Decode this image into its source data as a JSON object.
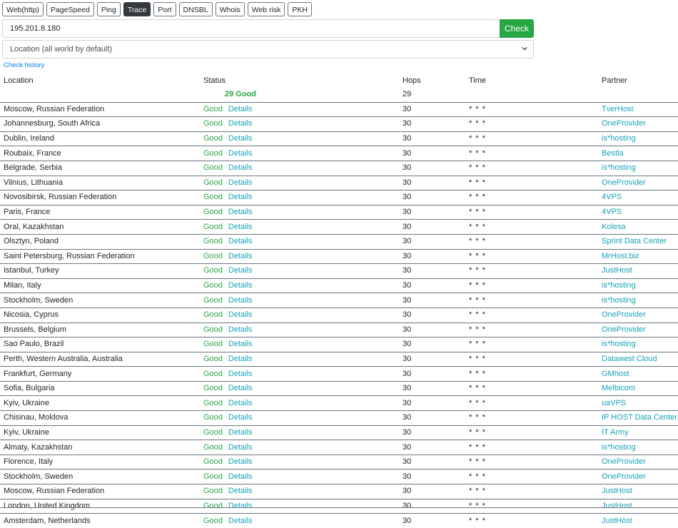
{
  "tabs": [
    {
      "label": "Web(http)",
      "active": false
    },
    {
      "label": "PageSpeed",
      "active": false
    },
    {
      "label": "Ping",
      "active": false
    },
    {
      "label": "Trace",
      "active": true
    },
    {
      "label": "Port",
      "active": false
    },
    {
      "label": "DNSBL",
      "active": false
    },
    {
      "label": "Whois",
      "active": false
    },
    {
      "label": "Web risk",
      "active": false
    },
    {
      "label": "PKH",
      "active": false
    }
  ],
  "search": {
    "value": "195.201.8.180",
    "button_label": "Check"
  },
  "location_select": {
    "selected": "Location (all world by default)"
  },
  "check_history_label": "Check history",
  "table": {
    "headers": [
      "Location",
      "Status",
      "Hops",
      "Time",
      "Partner"
    ],
    "summary": {
      "status": "29 Good",
      "hops": "29"
    },
    "rows": [
      {
        "location": "Moscow, Russian Federation",
        "status": "Good",
        "details": "Details",
        "hops": "30",
        "time": "* * *",
        "partner": "TverHost"
      },
      {
        "location": "Johannesburg, South Africa",
        "status": "Good",
        "details": "Details",
        "hops": "30",
        "time": "* * *",
        "partner": "OneProvider"
      },
      {
        "location": "Dublin, Ireland",
        "status": "Good",
        "details": "Details",
        "hops": "30",
        "time": "* * *",
        "partner": "is*hosting"
      },
      {
        "location": "Roubaix, France",
        "status": "Good",
        "details": "Details",
        "hops": "30",
        "time": "* * *",
        "partner": "Bestla"
      },
      {
        "location": "Belgrade, Serbia",
        "status": "Good",
        "details": "Details",
        "hops": "30",
        "time": "* * *",
        "partner": "is*hosting"
      },
      {
        "location": "Vilnius, Lithuania",
        "status": "Good",
        "details": "Details",
        "hops": "30",
        "time": "* * *",
        "partner": "OneProvider"
      },
      {
        "location": "Novosibirsk, Russian Federation",
        "status": "Good",
        "details": "Details",
        "hops": "30",
        "time": "* * *",
        "partner": "4VPS"
      },
      {
        "location": "Paris, France",
        "status": "Good",
        "details": "Details",
        "hops": "30",
        "time": "* * *",
        "partner": "4VPS"
      },
      {
        "location": "Oral, Kazakhstan",
        "status": "Good",
        "details": "Details",
        "hops": "30",
        "time": "* * *",
        "partner": "Kolesa"
      },
      {
        "location": "Olsztyn, Poland",
        "status": "Good",
        "details": "Details",
        "hops": "30",
        "time": "* * *",
        "partner": "Sprint Data Center"
      },
      {
        "location": "Saint Petersburg, Russian Federation",
        "status": "Good",
        "details": "Details",
        "hops": "30",
        "time": "* * *",
        "partner": "MrHost.biz"
      },
      {
        "location": "Istanbul, Turkey",
        "status": "Good",
        "details": "Details",
        "hops": "30",
        "time": "* * *",
        "partner": "JustHost"
      },
      {
        "location": "Milan, Italy",
        "status": "Good",
        "details": "Details",
        "hops": "30",
        "time": "* * *",
        "partner": "is*hosting"
      },
      {
        "location": "Stockholm, Sweden",
        "status": "Good",
        "details": "Details",
        "hops": "30",
        "time": "* * *",
        "partner": "is*hosting"
      },
      {
        "location": "Nicosia, Cyprus",
        "status": "Good",
        "details": "Details",
        "hops": "30",
        "time": "* * *",
        "partner": "OneProvider"
      },
      {
        "location": "Brussels, Belgium",
        "status": "Good",
        "details": "Details",
        "hops": "30",
        "time": "* * *",
        "partner": "OneProvider"
      },
      {
        "location": "Sao Paulo, Brazil",
        "status": "Good",
        "details": "Details",
        "hops": "30",
        "time": "* * *",
        "partner": "is*hosting"
      },
      {
        "location": "Perth, Western Australia, Australia",
        "status": "Good",
        "details": "Details",
        "hops": "30",
        "time": "* * *",
        "partner": "Datawest Cloud"
      },
      {
        "location": "Frankfurt, Germany",
        "status": "Good",
        "details": "Details",
        "hops": "30",
        "time": "* * *",
        "partner": "GMhost"
      },
      {
        "location": "Sofia, Bulgaria",
        "status": "Good",
        "details": "Details",
        "hops": "30",
        "time": "* * *",
        "partner": "Melbicom"
      },
      {
        "location": "Kyiv, Ukraine",
        "status": "Good",
        "details": "Details",
        "hops": "30",
        "time": "* * *",
        "partner": "uaVPS"
      },
      {
        "location": "Chisinau, Moldova",
        "status": "Good",
        "details": "Details",
        "hops": "30",
        "time": "* * *",
        "partner": "IP HOST Data Center"
      },
      {
        "location": "Kyiv, Ukraine",
        "status": "Good",
        "details": "Details",
        "hops": "30",
        "time": "* * *",
        "partner": "IT Army"
      },
      {
        "location": "Almaty, Kazakhstan",
        "status": "Good",
        "details": "Details",
        "hops": "30",
        "time": "* * *",
        "partner": "is*hosting"
      },
      {
        "location": "Florence, Italy",
        "status": "Good",
        "details": "Details",
        "hops": "30",
        "time": "* * *",
        "partner": "OneProvider"
      },
      {
        "location": "Stockholm, Sweden",
        "status": "Good",
        "details": "Details",
        "hops": "30",
        "time": "* * *",
        "partner": "OneProvider"
      },
      {
        "location": "Moscow, Russian Federation",
        "status": "Good",
        "details": "Details",
        "hops": "30",
        "time": "* * *",
        "partner": "JustHost"
      },
      {
        "location": "London, United Kingdom",
        "status": "Good",
        "details": "Details",
        "hops": "30",
        "time": "* * *",
        "partner": "JustHost"
      },
      {
        "location": "Amsterdam, Netherlands",
        "status": "Good",
        "details": "Details",
        "hops": "30",
        "time": "* * *",
        "partner": "JustHost"
      }
    ]
  },
  "colors": {
    "good": "#28a745",
    "link": "#17a2b8",
    "active_tab": "#343a40",
    "check_button": "#28a745"
  },
  "icons": {
    "select_caret": "chevron-down-icon"
  }
}
